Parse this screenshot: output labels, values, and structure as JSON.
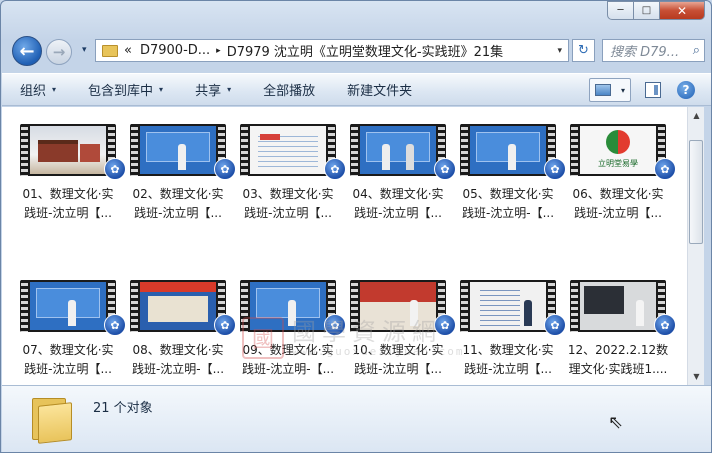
{
  "window": {
    "caption": {
      "minimize": "─",
      "maximize": "□",
      "close": "✕"
    }
  },
  "address": {
    "back_glyph": "←",
    "forward_glyph": "→",
    "history_caret": "▾",
    "overflow": "«",
    "crumbs": [
      "D7900-D...",
      "D7979 沈立明《立明堂数理文化-实践班》21集"
    ],
    "separator": "▸",
    "caret": "▾",
    "refresh_glyph": "↻",
    "search_placeholder": "搜索 D79...",
    "search_glyph": "⌕"
  },
  "toolbar": {
    "items": [
      {
        "label": "组织",
        "has_menu": true
      },
      {
        "label": "包含到库中",
        "has_menu": true
      },
      {
        "label": "共享",
        "has_menu": true
      },
      {
        "label": "全部播放",
        "has_menu": false
      },
      {
        "label": "新建文件夹",
        "has_menu": false
      }
    ],
    "help_glyph": "?",
    "menu_caret": "▾"
  },
  "files": [
    {
      "line1": "01、数理文化·实",
      "line2": "践班-沈立明【...",
      "scene": "temple"
    },
    {
      "line1": "02、数理文化·实",
      "line2": "践班-沈立明【...",
      "scene": "lecture"
    },
    {
      "line1": "03、数理文化·实",
      "line2": "践班-沈立明【...",
      "scene": "document"
    },
    {
      "line1": "04、数理文化·实",
      "line2": "践班-沈立明【...",
      "scene": "lecture2"
    },
    {
      "line1": "05、数理文化·实",
      "line2": "践班-沈立明-【...",
      "scene": "lecture"
    },
    {
      "line1": "06、数理文化·实",
      "line2": "践班-沈立明【...",
      "scene": "logo"
    },
    {
      "line1": "07、数理文化·实",
      "line2": "践班-沈立明【...",
      "scene": "lecture"
    },
    {
      "line1": "08、数理文化·实",
      "line2": "践班-沈立明-【...",
      "scene": "banner"
    },
    {
      "line1": "09、数理文化·实",
      "line2": "践班-沈立明-【...",
      "scene": "lecture"
    },
    {
      "line1": "10、数理文化·实",
      "line2": "践班-沈立明【...",
      "scene": "stage"
    },
    {
      "line1": "11、数理文化·实",
      "line2": "践班-沈立明【...",
      "scene": "slides"
    },
    {
      "line1": "12、2022.2.12数",
      "line2": "理文化·实践班1....",
      "scene": "screen"
    }
  ],
  "thumbnail_logo_text": "立明堂易學",
  "watermark": {
    "seal": "國",
    "name": "國學資源網",
    "url": "www.guoxueziyuan.com"
  },
  "media_badge_glyph": "✿",
  "status": {
    "count_text": "21 个对象"
  },
  "scroll": {
    "up": "▲",
    "down": "▼"
  },
  "cursor_glyph": "⇖",
  "colors": {
    "accent": "#1f5fb4",
    "toolbar_bg": "#dde7f3",
    "window_frame": "#c4d4e8",
    "close": "#c74f35"
  }
}
